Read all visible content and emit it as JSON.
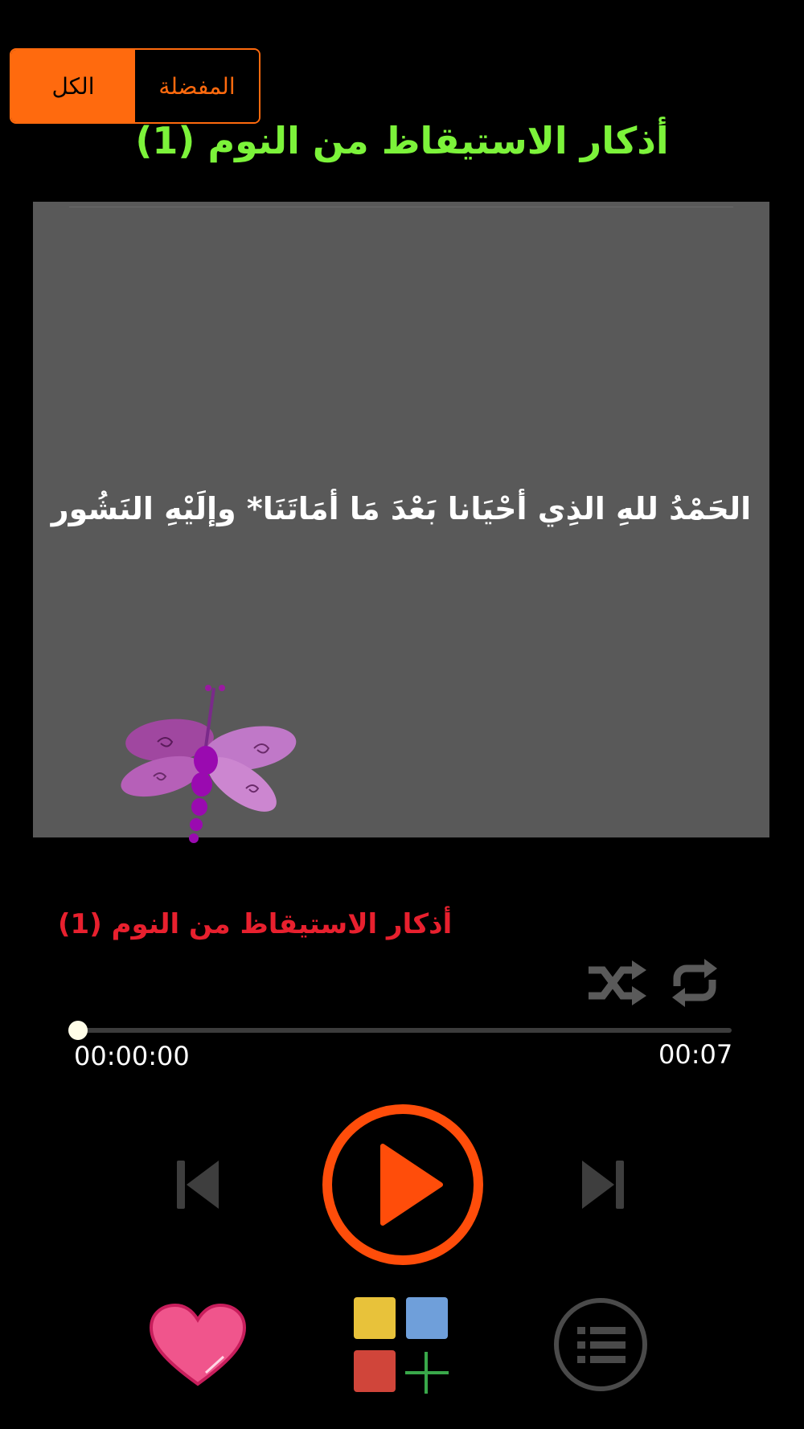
{
  "tabs": {
    "all_label": "الكل",
    "favorite_label": "المفضلة"
  },
  "header": {
    "title": "أذكار الاستيقاظ من النوم (1)"
  },
  "card": {
    "text": "الحَمْدُ للهِ الذِي أحْيَانا بَعْدَ مَا أمَاتَنَا* وإلَيْهِ النَشُور"
  },
  "player": {
    "track_title": "أذكار الاستيقاظ من النوم (1)",
    "elapsed": "00:00:00",
    "duration": "00:07",
    "progress": 0
  },
  "colors": {
    "accent_orange": "#ff6a0e",
    "title_green": "#7cf33a",
    "track_red": "#e8202e",
    "play_orange": "#ff4d0a",
    "heart_pink": "#f0558c"
  }
}
